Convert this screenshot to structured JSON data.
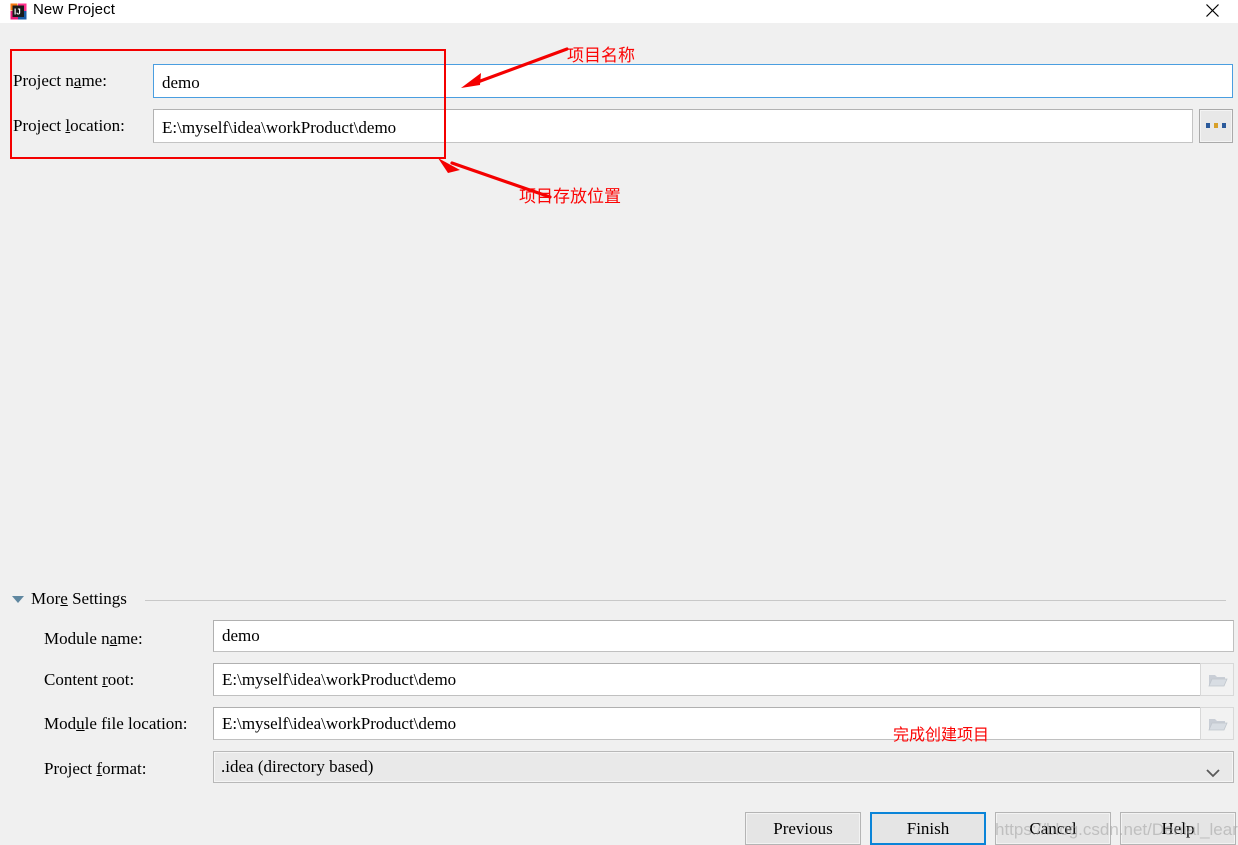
{
  "window": {
    "title": "New Project",
    "icon": "intellij-idea-icon",
    "close_label": "×"
  },
  "top_form": {
    "project_name": {
      "label_before": "Project n",
      "label_mnemonic": "a",
      "label_after": "me:",
      "label_full": "Project name:",
      "value": "demo"
    },
    "project_location": {
      "label_before": "Project ",
      "label_mnemonic": "l",
      "label_after": "ocation:",
      "label_full": "Project location:",
      "value": "E:\\myself\\idea\\workProduct\\demo"
    },
    "browse_button": "..."
  },
  "more_settings": {
    "header_before": "Mor",
    "header_mnemonic": "e",
    "header_after": " Settings",
    "header_full": "More Settings",
    "fields": [
      {
        "label_before": "Module n",
        "label_mnemonic": "a",
        "label_after": "me:",
        "label_full": "Module name:",
        "value": "demo",
        "has_folder_button": false
      },
      {
        "label_before": "Content ",
        "label_mnemonic": "r",
        "label_after": "oot:",
        "label_full": "Content root:",
        "value": "E:\\myself\\idea\\workProduct\\demo",
        "has_folder_button": true
      },
      {
        "label_before": "Mod",
        "label_mnemonic": "u",
        "label_after": "le file location:",
        "label_full": "Module file location:",
        "value": "E:\\myself\\idea\\workProduct\\demo",
        "has_folder_button": true
      }
    ],
    "project_format": {
      "label_before": "Project ",
      "label_mnemonic": "f",
      "label_after": "ormat:",
      "label_full": "Project format:",
      "value": ".idea (directory based)",
      "options": [
        ".idea (directory based)"
      ]
    }
  },
  "buttons": {
    "previous": "Previous",
    "finish": "Finish",
    "cancel": "Cancel",
    "help": "Help"
  },
  "annotations": {
    "project_name": "项目名称",
    "project_location": "项目存放位置",
    "finish": "完成创建项目",
    "color": "#fb0505"
  },
  "watermark": "https://blog.csdn.net/Denial_learn",
  "colors": {
    "background": "#f0f0f0",
    "titlebar": "#ffffff",
    "focus_border": "#4a9ee0",
    "default_button_border": "#0a84d8",
    "annotation_red": "#fb0505"
  }
}
